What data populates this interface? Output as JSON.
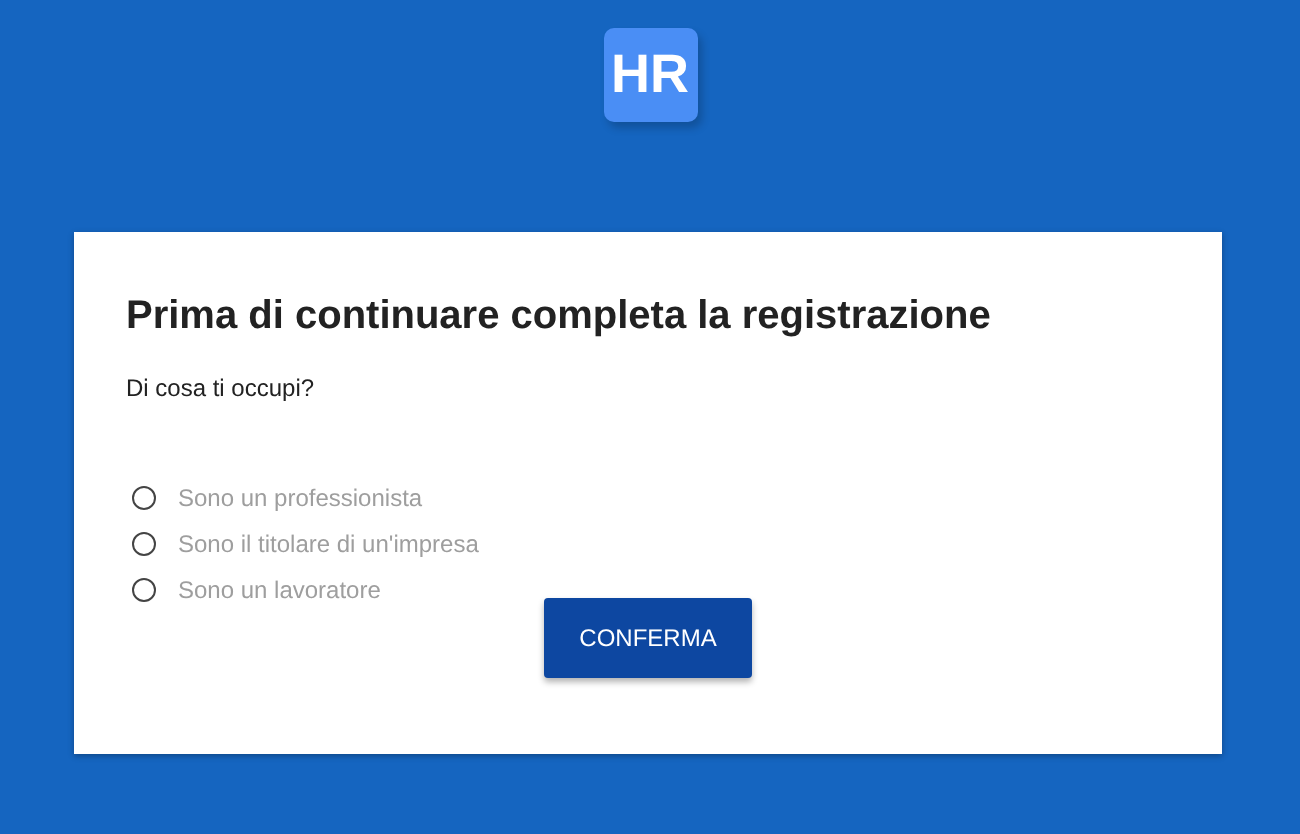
{
  "logo": {
    "text": "HR"
  },
  "card": {
    "title": "Prima di continuare completa la registrazione",
    "question": "Di cosa ti occupi?",
    "options": [
      {
        "label": "Sono un professionista",
        "selected": false
      },
      {
        "label": "Sono il titolare di un'impresa",
        "selected": false
      },
      {
        "label": "Sono un lavoratore",
        "selected": false
      }
    ],
    "button": "CONFERMA"
  }
}
